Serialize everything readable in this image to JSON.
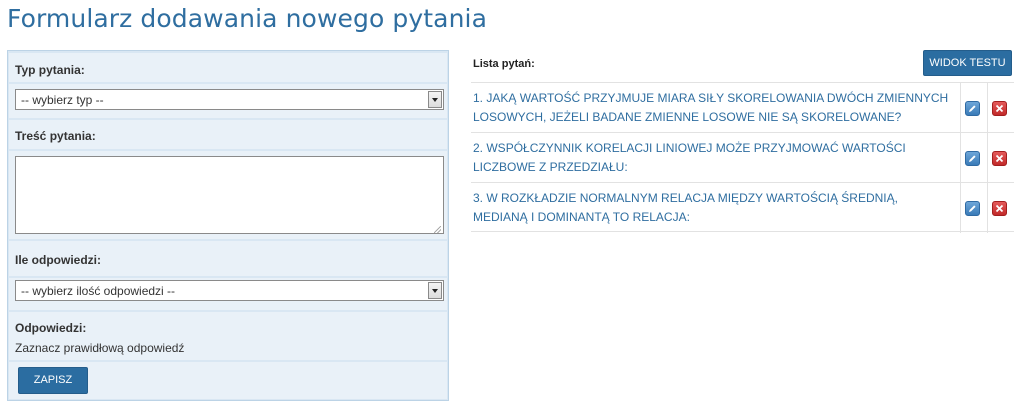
{
  "page": {
    "title": "Formularz dodawania nowego pytania"
  },
  "form": {
    "type_label": "Typ pytania:",
    "type_select_value": "-- wybierz typ --",
    "content_label": "Treść pytania:",
    "content_value": "",
    "answers_count_label": "Ile odpowiedzi:",
    "answers_count_select_value": "-- wybierz ilość odpowiedzi --",
    "answers_label": "Odpowiedzi:",
    "answers_note": "Zaznacz prawidłową odpowiedź",
    "save_label": "ZAPISZ"
  },
  "list": {
    "header_label": "Lista pytań:",
    "view_test_label": "WIDOK TESTU",
    "questions": [
      {
        "number": "1.",
        "text": "JAKĄ WARTOŚĆ PRZYJMUJE MIARA SIŁY SKORELOWANIA DWÓCH ZMIENNYCH LOSOWYCH, JEŻELI BADANE ZMIENNE LOSOWE NIE SĄ SKORELOWANE?"
      },
      {
        "number": "2.",
        "text": "WSPÓŁCZYNNIK KORELACJI LINIOWEJ MOŻE PRZYJMOWAĆ WARTOŚCI LICZBOWE Z PRZEDZIAŁU:"
      },
      {
        "number": "3.",
        "text": "W ROZKŁADZIE NORMALNYM RELACJA MIĘDZY WARTOŚCIĄ ŚREDNIĄ, MEDIANĄ I DOMINANTĄ TO RELACJA:"
      }
    ]
  },
  "icons": {
    "edit": "pencil-icon",
    "delete": "close-icon",
    "dropdown": "chevron-down-icon"
  },
  "colors": {
    "accent": "#2f6ea0",
    "button": "#2b6da1",
    "form_bg": "#e9f1f8",
    "edit_icon": "#3a7bb8",
    "delete_icon": "#c12a2a"
  }
}
